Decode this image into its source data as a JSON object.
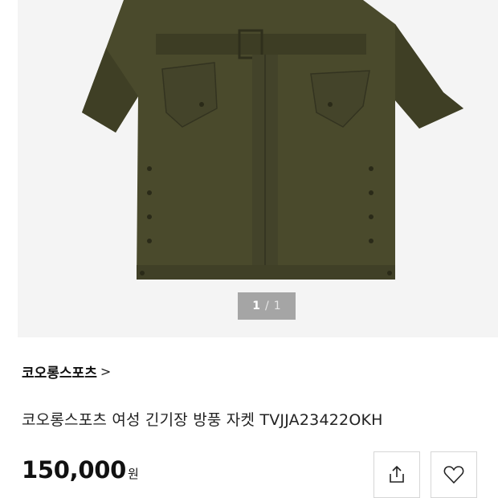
{
  "gallery": {
    "current_index": "1",
    "separator": "/",
    "total": "1"
  },
  "product": {
    "brand": "코오롱스포츠",
    "brand_chevron": ">",
    "title": "코오롱스포츠 여성 긴기장 방풍 자켓 TVJJA23422OKH",
    "price": "150,000",
    "currency": "원",
    "coat_color": "#4a4a2c"
  },
  "actions": {
    "share_icon": "share-icon",
    "wishlist_icon": "heart-icon"
  }
}
